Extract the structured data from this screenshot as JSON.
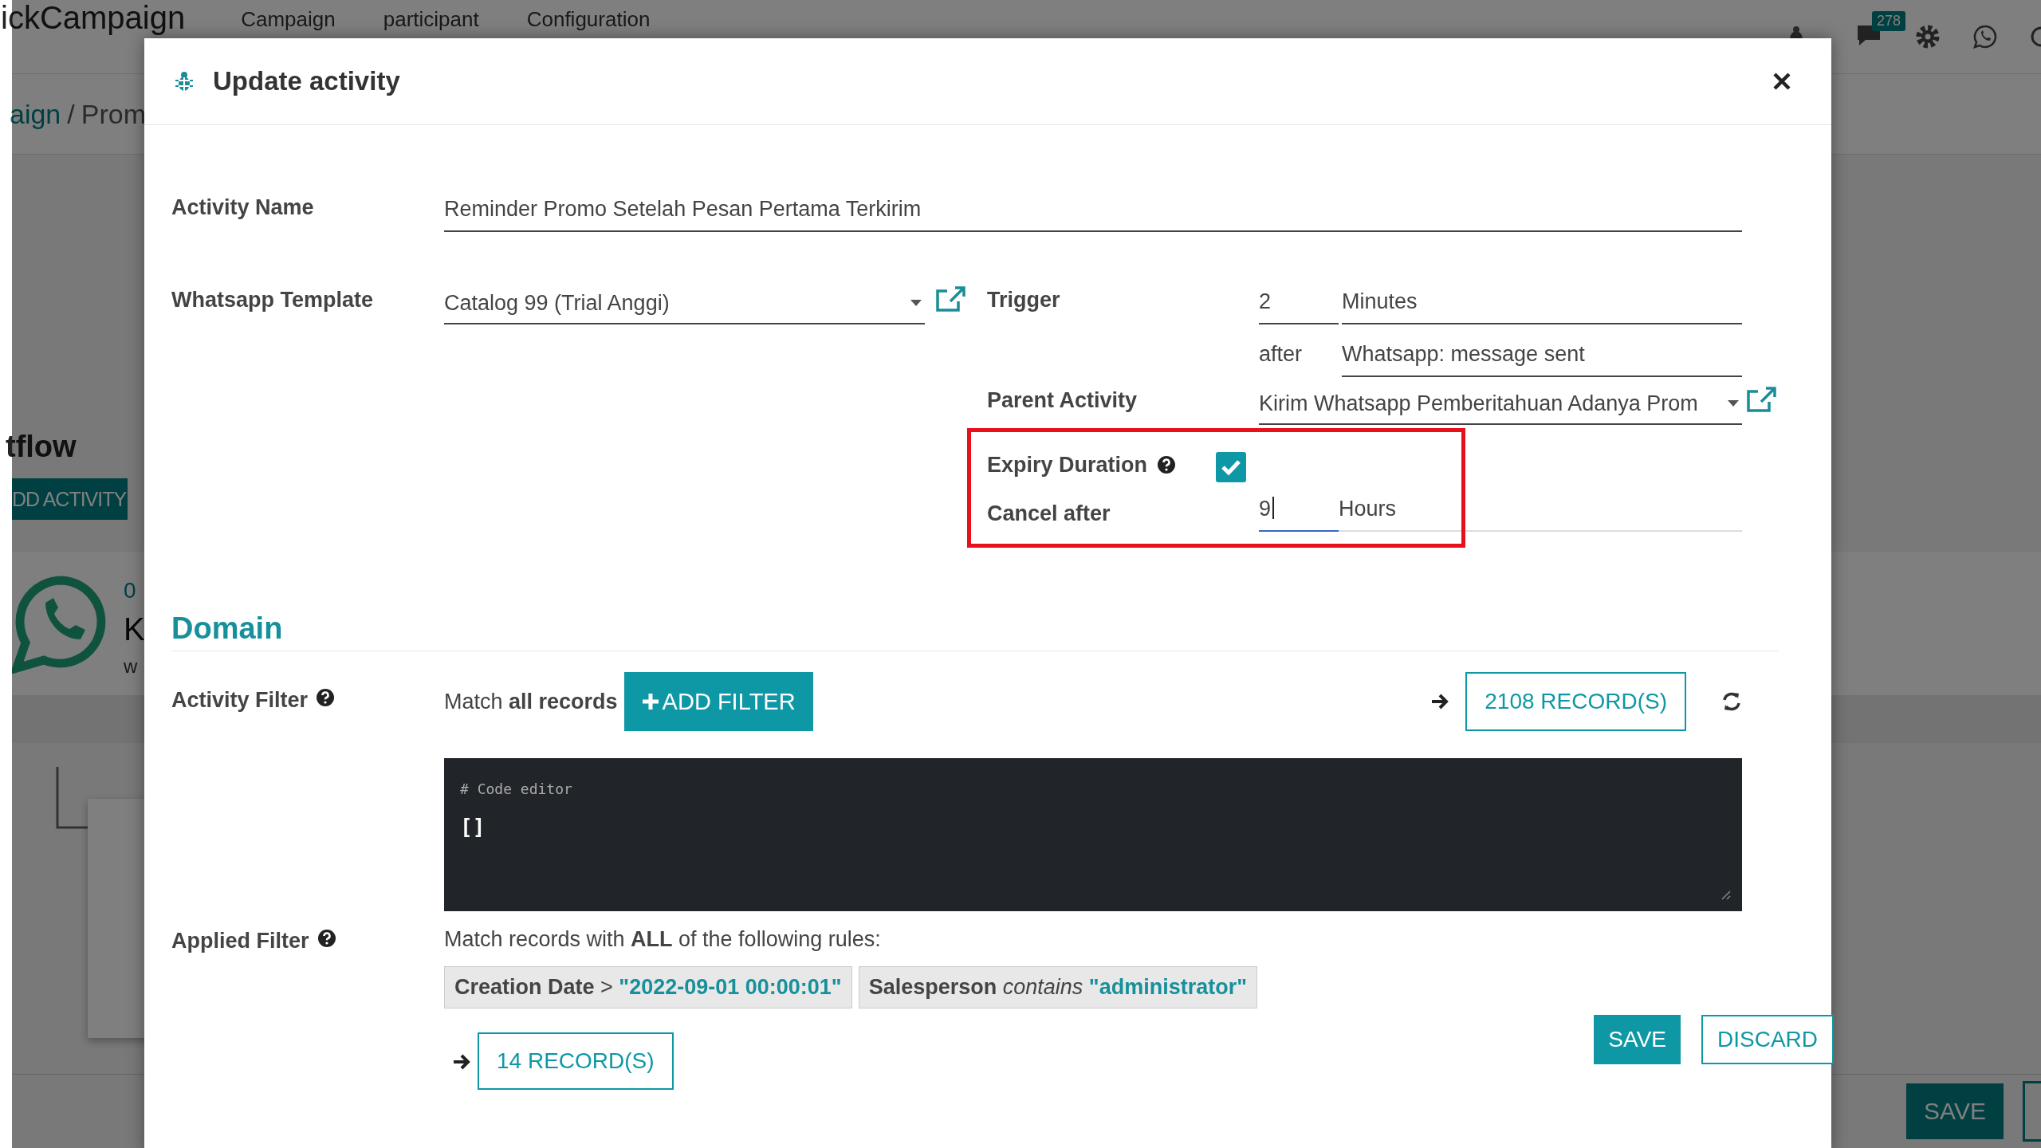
{
  "background": {
    "app_name": "ickCampaign",
    "menu": [
      "Campaign",
      "participant",
      "Configuration"
    ],
    "message_count": "278",
    "breadcrumb": [
      "aign",
      "Prom"
    ],
    "breadcrumb_separator": "/",
    "section_title": "tflow",
    "add_activity_button": "DD ACTIVITY",
    "card": {
      "number": "0",
      "title": "K",
      "subtitle": "w"
    },
    "save_button": "SAVE"
  },
  "modal": {
    "title": "Update activity",
    "activity_name": {
      "label": "Activity Name",
      "value": "Reminder Promo Setelah Pesan Pertama Terkirim"
    },
    "whatsapp_template": {
      "label": "Whatsapp Template",
      "value": "Catalog 99 (Trial Anggi)"
    },
    "trigger": {
      "label": "Trigger",
      "amount": "2",
      "unit": "Minutes",
      "after_label": "after",
      "event": "Whatsapp: message sent"
    },
    "parent_activity": {
      "label": "Parent Activity",
      "value": "Kirim Whatsapp Pemberitahuan Adanya Prom"
    },
    "expiry_highlighted": true,
    "expiry_duration": {
      "label": "Expiry Duration",
      "checked": true
    },
    "cancel_after": {
      "label": "Cancel after",
      "value": "9",
      "unit": "Hours",
      "focused": true
    },
    "domain": {
      "heading": "Domain",
      "activity_filter": {
        "label": "Activity Filter",
        "match_text": "Match **all records**",
        "add_button": "ADD FILTER",
        "records_button": "2108 RECORD(S)"
      },
      "code_editor": {
        "comment": "# Code editor",
        "code": "[]"
      },
      "applied_filter": {
        "label": "Applied Filter",
        "rules_text": "Match records with **ALL** of the following rules:",
        "chips": [
          {
            "field": "Creation Date",
            "operator": ">",
            "operator_italic": false,
            "value": "\"2022-09-01 00:00:01\""
          },
          {
            "field": "Salesperson",
            "operator": "contains",
            "operator_italic": true,
            "value": "\"administrator\""
          }
        ],
        "records_button": "14 RECORD(S)"
      }
    },
    "buttons": [
      {
        "label": "SAVE",
        "kind": "primary"
      },
      {
        "label": "DISCARD",
        "kind": "secondary"
      }
    ]
  }
}
